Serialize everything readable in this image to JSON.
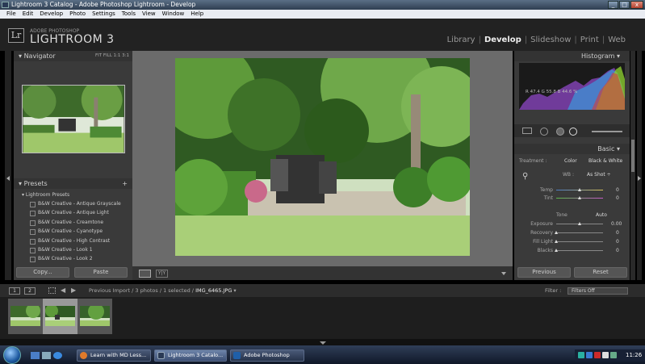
{
  "window": {
    "title": "Lightroom 3 Catalog - Adobe Photoshop Lightroom - Develop",
    "min": "_",
    "max": "□",
    "close": "x"
  },
  "menu": [
    "File",
    "Edit",
    "Develop",
    "Photo",
    "Settings",
    "Tools",
    "View",
    "Window",
    "Help"
  ],
  "brand": {
    "logo": "Lr",
    "small": "ADOBE PHOTOSHOP",
    "big": "LIGHTROOM 3"
  },
  "modules": [
    {
      "label": "Library",
      "active": false
    },
    {
      "label": "Develop",
      "active": true
    },
    {
      "label": "Slideshow",
      "active": false
    },
    {
      "label": "Print",
      "active": false
    },
    {
      "label": "Web",
      "active": false
    }
  ],
  "navigator": {
    "title": "Navigator",
    "options": "FIT   FILL   1:1   3:1"
  },
  "presets": {
    "title": "Presets",
    "folder": "Lightroom Presets",
    "items": [
      "B&W Creative - Antique Grayscale",
      "B&W Creative - Antique Light",
      "B&W Creative - Creamtone",
      "B&W Creative - Cyanotype",
      "B&W Creative - High Contrast",
      "B&W Creative - Look 1",
      "B&W Creative - Look 2"
    ]
  },
  "left_buttons": {
    "copy": "Copy...",
    "paste": "Paste"
  },
  "histogram": {
    "title": "Histogram",
    "readout": "R  47.4   G  55.8   B  44.6 %"
  },
  "basic": {
    "title": "Basic",
    "treatment_label": "Treatment :",
    "treatment_color": "Color",
    "treatment_bw": "Black & White",
    "wb_label": "WB :",
    "wb_value": "As Shot ÷",
    "temp": {
      "label": "Temp",
      "value": "0",
      "pos": 0.5
    },
    "tint": {
      "label": "Tint",
      "value": "0",
      "pos": 0.5
    },
    "tone_label": "Tone",
    "auto_label": "Auto",
    "exposure": {
      "label": "Exposure",
      "value": "0.00",
      "pos": 0.5
    },
    "recovery": {
      "label": "Recovery",
      "value": "0",
      "pos": 0.0
    },
    "fill_light": {
      "label": "Fill Light",
      "value": "0",
      "pos": 0.0
    },
    "blacks": {
      "label": "Blacks",
      "value": "0",
      "pos": 0.0
    }
  },
  "right_buttons": {
    "previous": "Previous",
    "reset": "Reset"
  },
  "filmstrip_bar": {
    "view1": "1",
    "view2": "2",
    "path_prefix": "Previous Import / 3 photos / 1 selected /",
    "filename": "IMG_6465.JPG",
    "filter_label": "Filter :",
    "filter_value": "Filters Off"
  },
  "taskbar": {
    "tasks": [
      {
        "label": "Learn with MD Less...",
        "active": false
      },
      {
        "label": "Lightroom 3 Catalo...",
        "active": true
      },
      {
        "label": "Adobe Photoshop",
        "active": false
      }
    ],
    "clock": "11:26"
  },
  "colors": {
    "accent": "#eeeeee",
    "panel": "#3a3a3a",
    "canvas": "#6b6b6b"
  }
}
